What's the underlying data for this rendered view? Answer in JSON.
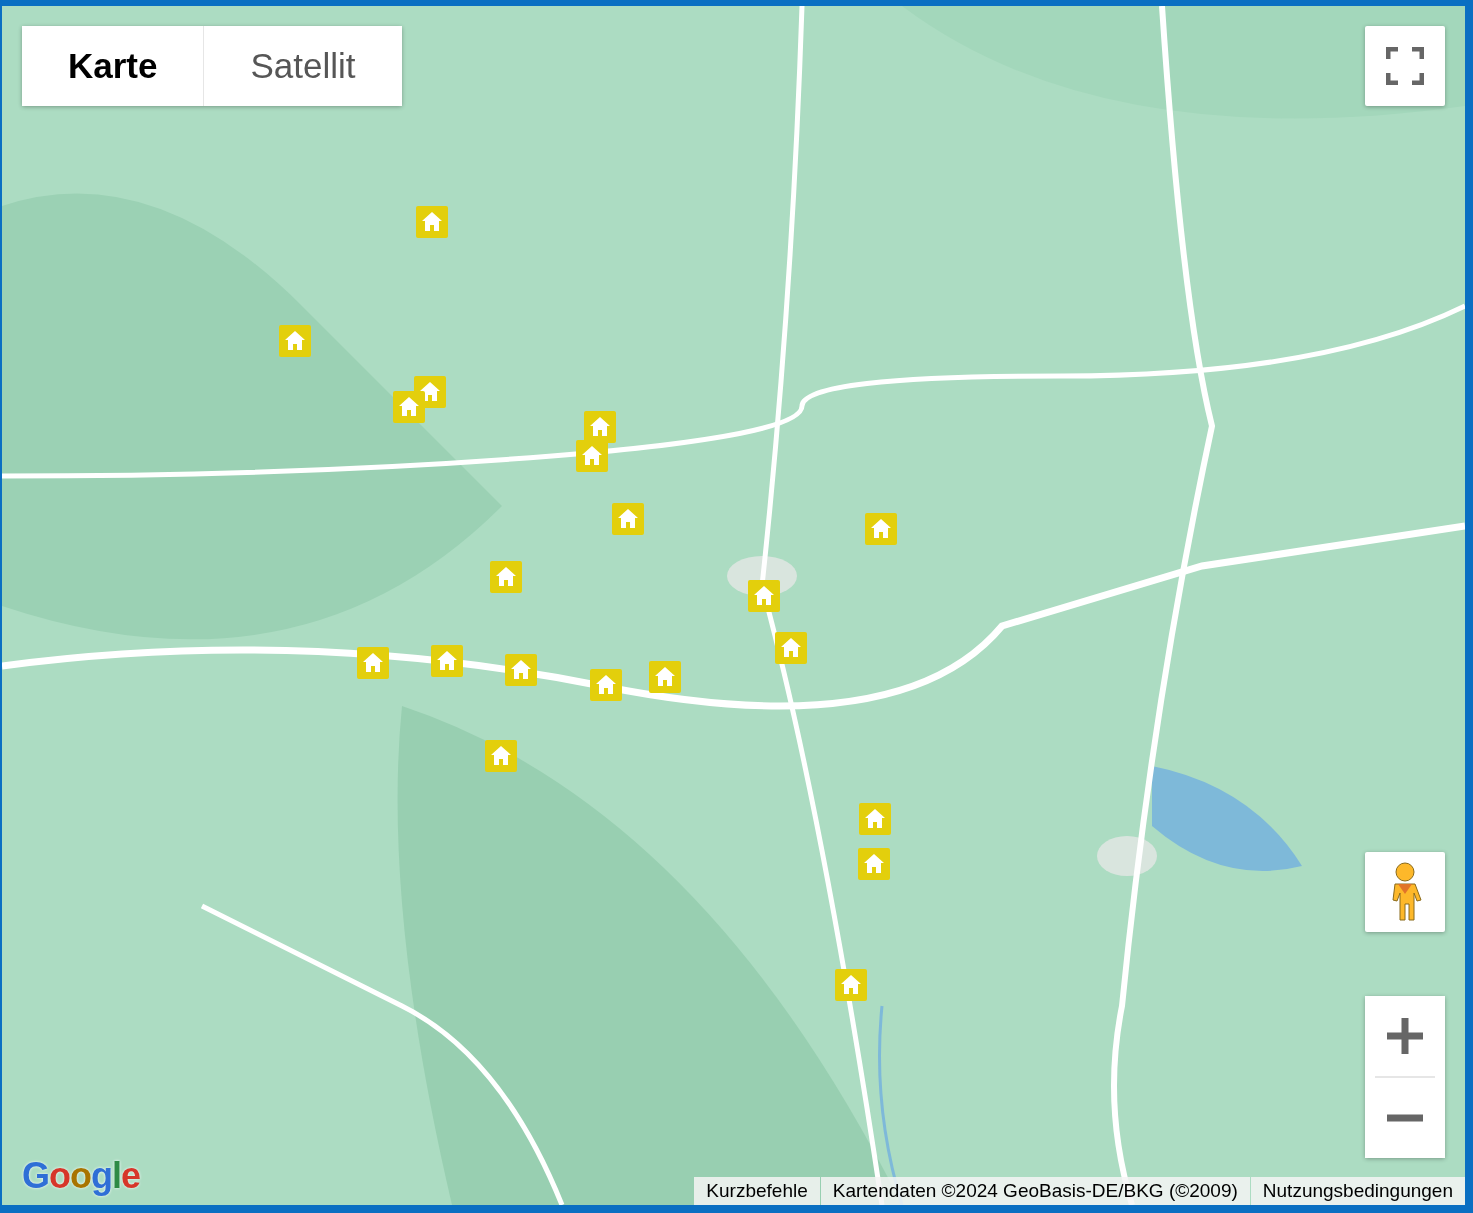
{
  "map_type_tabs": [
    {
      "label": "Karte",
      "selected": true
    },
    {
      "label": "Satellit",
      "selected": false
    }
  ],
  "logo": "Google",
  "footer": [
    "Kurzbefehle",
    "Kartendaten ©2024 GeoBasis-DE/BKG (©2009)",
    "Nutzungsbedingungen"
  ]
}
